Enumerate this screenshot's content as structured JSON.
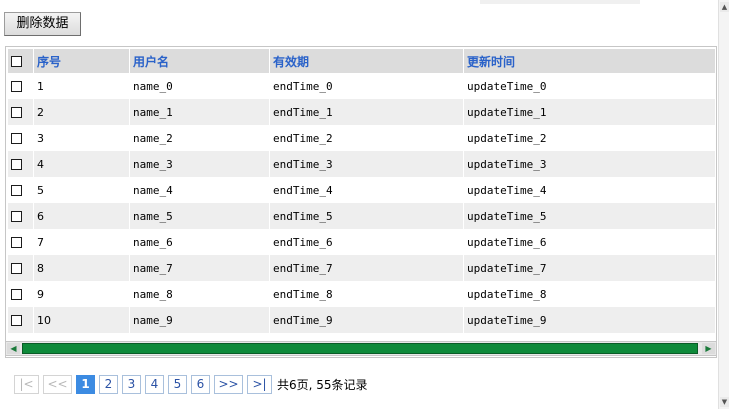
{
  "toolbar": {
    "delete_label": "删除数据"
  },
  "table": {
    "headers": [
      "序号",
      "用户名",
      "有效期",
      "更新时间"
    ],
    "rows": [
      {
        "seq": "1",
        "name": "name_0",
        "end": "endTime_0",
        "update": "updateTime_0"
      },
      {
        "seq": "2",
        "name": "name_1",
        "end": "endTime_1",
        "update": "updateTime_1"
      },
      {
        "seq": "3",
        "name": "name_2",
        "end": "endTime_2",
        "update": "updateTime_2"
      },
      {
        "seq": "4",
        "name": "name_3",
        "end": "endTime_3",
        "update": "updateTime_3"
      },
      {
        "seq": "5",
        "name": "name_4",
        "end": "endTime_4",
        "update": "updateTime_4"
      },
      {
        "seq": "6",
        "name": "name_5",
        "end": "endTime_5",
        "update": "updateTime_5"
      },
      {
        "seq": "7",
        "name": "name_6",
        "end": "endTime_6",
        "update": "updateTime_6"
      },
      {
        "seq": "8",
        "name": "name_7",
        "end": "endTime_7",
        "update": "updateTime_7"
      },
      {
        "seq": "9",
        "name": "name_8",
        "end": "endTime_8",
        "update": "updateTime_8"
      },
      {
        "seq": "10",
        "name": "name_9",
        "end": "endTime_9",
        "update": "updateTime_9"
      }
    ]
  },
  "scrollbar": {
    "left_icon": "arrow-left-icon",
    "right_icon": "arrow-right-icon"
  },
  "pager": {
    "first": "|<",
    "prev": "<<",
    "pages": [
      "1",
      "2",
      "3",
      "4",
      "5",
      "6"
    ],
    "current_page": "1",
    "next": ">>",
    "last": ">|",
    "summary": "共6页, 55条记录"
  },
  "colors": {
    "header_text": "#2a62c9",
    "active_page": "#3c8be2",
    "scroll_thumb": "#0e8a3a"
  }
}
